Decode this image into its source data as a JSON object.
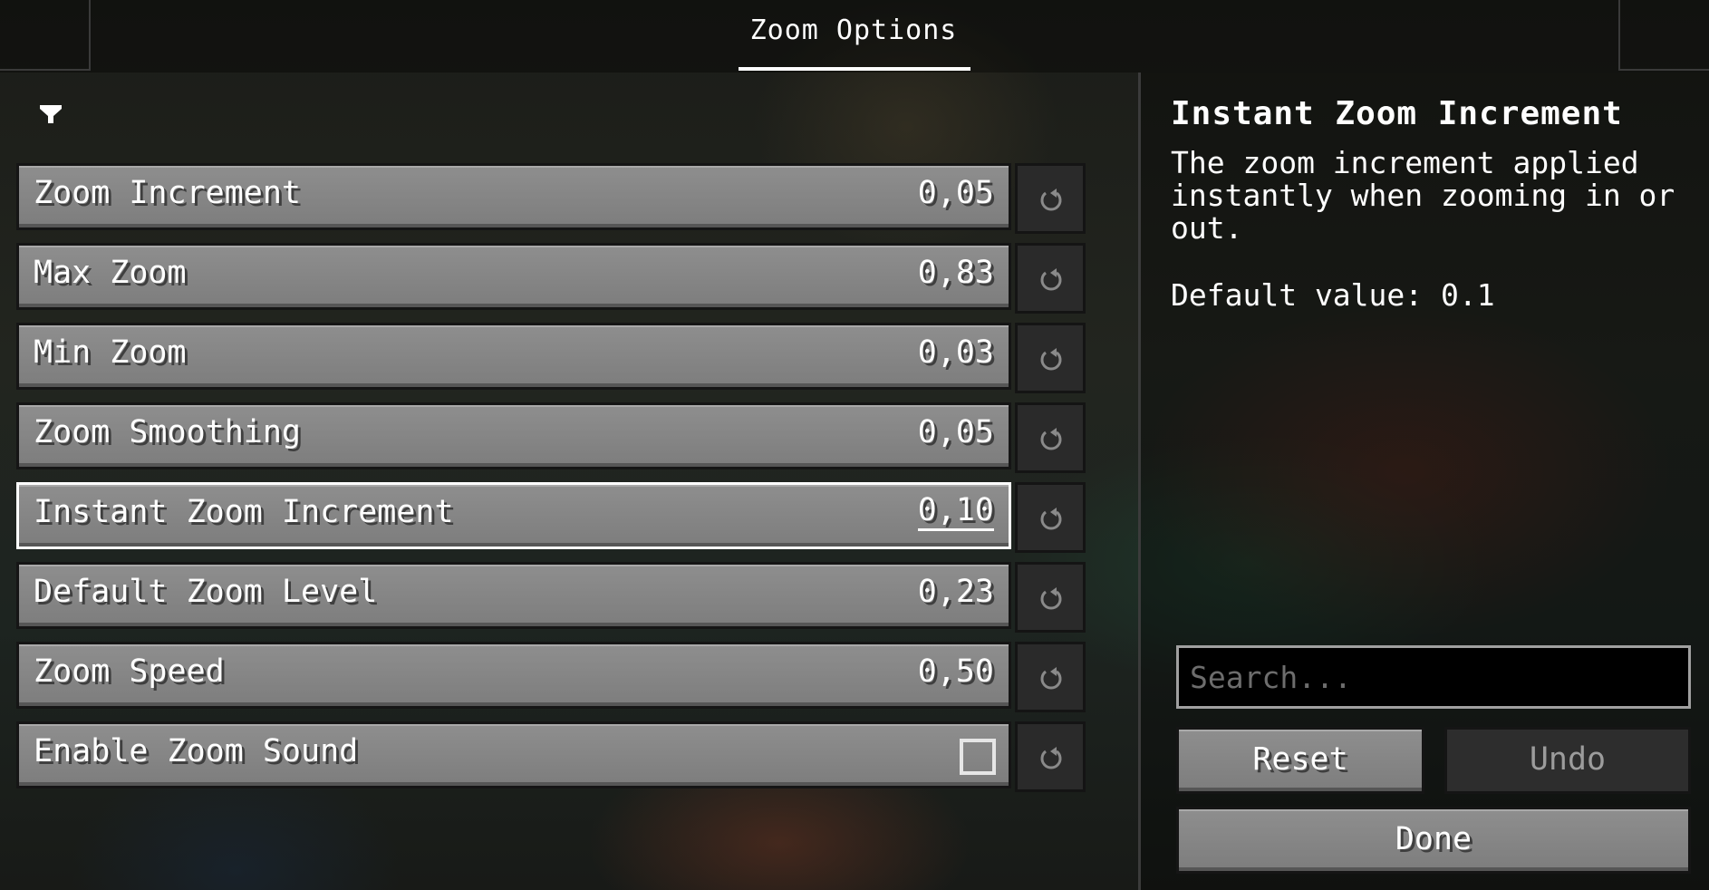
{
  "header": {
    "tab_label": "Zoom Options"
  },
  "toolbar": {
    "filter_icon": "filter-icon"
  },
  "options": [
    {
      "label": "Zoom Increment",
      "value": "0,05",
      "type": "slider"
    },
    {
      "label": "Max Zoom",
      "value": "0,83",
      "type": "slider"
    },
    {
      "label": "Min Zoom",
      "value": "0,03",
      "type": "slider"
    },
    {
      "label": "Zoom Smoothing",
      "value": "0,05",
      "type": "slider"
    },
    {
      "label": "Instant Zoom Increment",
      "value": "0,10",
      "type": "slider",
      "focused": true
    },
    {
      "label": "Default Zoom Level",
      "value": "0,23",
      "type": "slider"
    },
    {
      "label": "Zoom Speed",
      "value": "0,50",
      "type": "slider"
    },
    {
      "label": "Enable Zoom Sound",
      "value": false,
      "type": "checkbox"
    }
  ],
  "reset_icon": "reset-arrow-icon",
  "info": {
    "title": "Instant Zoom Increment",
    "description": "The zoom increment applied instantly when zooming in or out.",
    "default_value": "Default value: 0.1"
  },
  "search": {
    "placeholder": "Search...",
    "value": ""
  },
  "buttons": {
    "reset": "Reset",
    "undo": "Undo",
    "done": "Done"
  },
  "colors": {
    "button_face": "#8e8e8e",
    "button_border": "#151515",
    "focus_outline": "#ffffff",
    "disabled_button": "#2d2d2d"
  }
}
